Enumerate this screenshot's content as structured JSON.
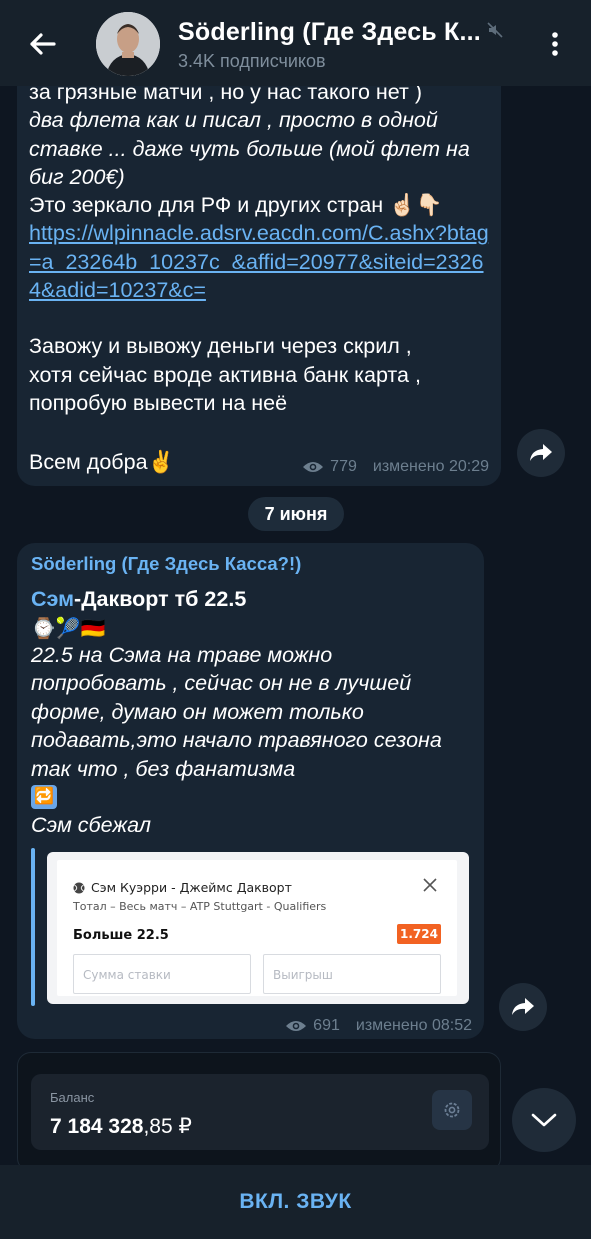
{
  "header": {
    "title": "Söderling (Где Здесь К...",
    "subscribers": "3.4K подписчиков"
  },
  "message1": {
    "lines": [
      "за грязные матчи , но у нас такого нет )",
      "два флета как и писал , просто в одной",
      "ставке ... даже чуть больше (мой флет на",
      "биг 200€)",
      "Это зеркало для РФ и других стран ☝🏻👇🏻",
      "Завожу и вывожу деньги через скрил ,",
      "хотя сейчас вроде активна банк карта ,",
      "попробую вывести на неё",
      "Всем добра✌️"
    ],
    "link": "https://wlpinnacle.adsrv.eacdn.com/C.ashx?btag=a_23264b_10237c_&affid=20977&siteid=23264&adid=10237&c=",
    "views": "779",
    "edited": "изменено 20:29"
  },
  "date_separator": "7 июня",
  "message2": {
    "author": "Söderling (Где Здесь Касса?!)",
    "headline_link": "Сэм",
    "headline_rest": "-Дакворт тб 22.5",
    "emoji": "⌚🎾🇩🇪",
    "body_lines": [
      "22.5 на Сэма на траве можно",
      "попробовать , сейчас он не в лучшей",
      "форме, думаю он может только",
      "подавать,это начало травяного сезона",
      "так что , без фанатизма"
    ],
    "repeat_emoji": "🔁",
    "result": "Сэм сбежал",
    "bet": {
      "match": "Сэм Куэрри - Джеймс Дакворт",
      "market": "Тотал – Весь матч – ATP Stuttgart - Qualifiers",
      "pick": "Больше 22.5",
      "odds": "1.724",
      "stake_placeholder": "Сумма ставки",
      "win_placeholder": "Выигрыш"
    },
    "views": "691",
    "edited": "изменено 08:52"
  },
  "balance": {
    "label": "Баланс",
    "amount_main": "7 184 328",
    "amount_cents": ",85 ₽"
  },
  "bottom": {
    "unmute_label": "ВКЛ. ЗВУК"
  },
  "colors": {
    "background": "#0e1621",
    "header": "#17212b",
    "bubble": "#182533",
    "link": "#6ab3f3",
    "odds": "#f26222"
  }
}
